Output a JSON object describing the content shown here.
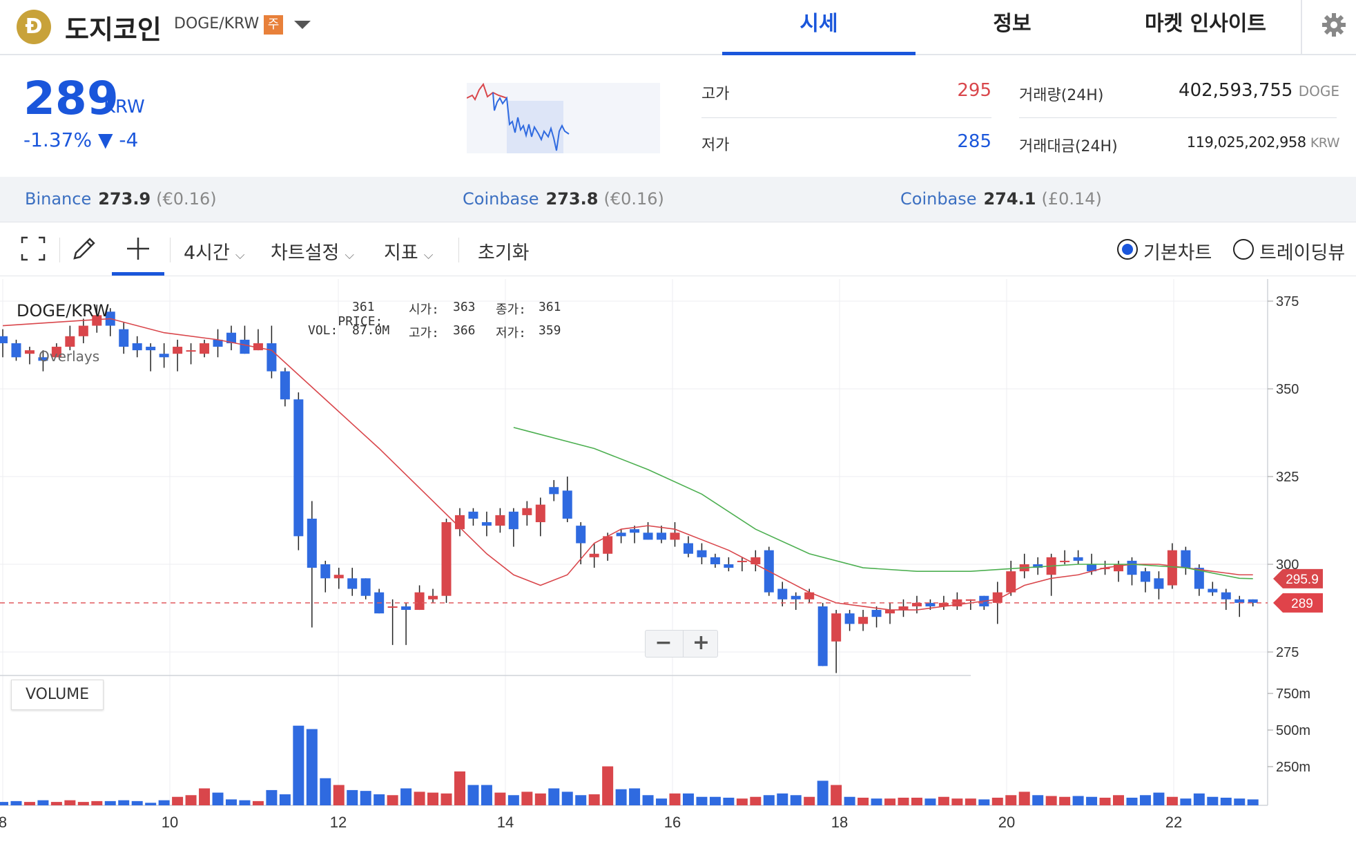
{
  "header": {
    "logo_letter": "Ð",
    "coin_name": "도지코인",
    "pair": "DOGE/KRW",
    "warning_badge": "주",
    "tabs": [
      {
        "label": "시세",
        "active": true
      },
      {
        "label": "정보",
        "active": false
      },
      {
        "label": "마켓 인사이트",
        "active": false
      }
    ]
  },
  "summary": {
    "price": "289",
    "unit": "KRW",
    "change": "-1.37% ▼ -4",
    "high_label": "고가",
    "high_value": "295",
    "low_label": "저가",
    "low_value": "285",
    "volume_label": "거래량(24H)",
    "volume_value": "402,593,755",
    "volume_unit": "DOGE",
    "amount_label": "거래대금(24H)",
    "amount_value": "119,025,202,958",
    "amount_unit": "KRW"
  },
  "exchanges": [
    {
      "name": "Binance",
      "price": "273.9",
      "converted": "(€0.16)"
    },
    {
      "name": "Coinbase",
      "price": "273.8",
      "converted": "(€0.16)"
    },
    {
      "name": "Coinbase",
      "price": "274.1",
      "converted": "(£0.14)"
    }
  ],
  "toolbar": {
    "interval": "4시간",
    "chart_settings": "차트설정",
    "indicators": "지표",
    "reset": "초기화",
    "basic_chart": "기본차트",
    "trading_view": "트레이딩뷰",
    "selected_view": "기본차트"
  },
  "chart_info": {
    "symbol": "DOGE/KRW",
    "overlays_label": "Overlays",
    "price_label": "PRICE:",
    "price_value": "361",
    "open_label": "시가:",
    "open_value": "363",
    "close_label": "종가:",
    "close_value": "361",
    "vol_label": "VOL:",
    "vol_value": "87.0M",
    "high_label": "고가:",
    "high_value": "366",
    "low_label": "저가:",
    "low_value": "359",
    "volume_panel_label": "VOLUME",
    "zoom_out": "−",
    "zoom_in": "+"
  },
  "colors": {
    "up": "#d9464b",
    "down": "#2f6ae0",
    "ma_short": "#d9464b",
    "ma_long": "#4caf50",
    "accent": "#1a56db"
  },
  "chart_data": {
    "type": "candlestick",
    "x_ticks": [
      "8",
      "10",
      "12",
      "14",
      "16",
      "18",
      "20",
      "22"
    ],
    "y_ticks": [
      375,
      350,
      325,
      300,
      275
    ],
    "volume_ticks": [
      "750m",
      "500m",
      "250m"
    ],
    "ylim": [
      271,
      375
    ],
    "current_price": 289,
    "ma_label_value": "295.9",
    "current_label_value": "289",
    "candles": [
      [
        365,
        363,
        367,
        359
      ],
      [
        363,
        359,
        364,
        358
      ],
      [
        360,
        361,
        362,
        357
      ],
      [
        359,
        358,
        361,
        355
      ],
      [
        359,
        362,
        363,
        359
      ],
      [
        362,
        365,
        368,
        361
      ],
      [
        365,
        368,
        370,
        363
      ],
      [
        368,
        371,
        374,
        366
      ],
      [
        372,
        368,
        373,
        365
      ],
      [
        367,
        362,
        369,
        360
      ],
      [
        363,
        361,
        365,
        359
      ],
      [
        362,
        361,
        363,
        355
      ],
      [
        360,
        359,
        363,
        356
      ],
      [
        360,
        362,
        364,
        355
      ],
      [
        361,
        361,
        363,
        357
      ],
      [
        360,
        363,
        364,
        359
      ],
      [
        364,
        362,
        367,
        359
      ],
      [
        366,
        363,
        368,
        361
      ],
      [
        364,
        360,
        368,
        360
      ],
      [
        361,
        363,
        367,
        361
      ],
      [
        363,
        355,
        368,
        353
      ],
      [
        355,
        347,
        356,
        345
      ],
      [
        347,
        308,
        349,
        304
      ],
      [
        313,
        299,
        318,
        282
      ],
      [
        300,
        296,
        301,
        292
      ],
      [
        296,
        297,
        299,
        293
      ],
      [
        296,
        293,
        299,
        291
      ],
      [
        296,
        291,
        296,
        290
      ],
      [
        292,
        286,
        293,
        286
      ],
      [
        288,
        288,
        290,
        277
      ],
      [
        288,
        287,
        289,
        277
      ],
      [
        287,
        292,
        294,
        287
      ],
      [
        290,
        291,
        293,
        289
      ],
      [
        291,
        312,
        313,
        289
      ],
      [
        310,
        314,
        316,
        308
      ],
      [
        315,
        313,
        316,
        311
      ],
      [
        312,
        311,
        315,
        308
      ],
      [
        311,
        314,
        316,
        309
      ],
      [
        315,
        310,
        316,
        305
      ],
      [
        314,
        316,
        318,
        311
      ],
      [
        312,
        317,
        319,
        308
      ],
      [
        322,
        320,
        324,
        318
      ],
      [
        321,
        313,
        325,
        312
      ],
      [
        311,
        306,
        312,
        300
      ],
      [
        302,
        303,
        306,
        299
      ],
      [
        303,
        308,
        309,
        301
      ],
      [
        309,
        308,
        310,
        306
      ],
      [
        310,
        309,
        311,
        306
      ],
      [
        309,
        307,
        312,
        307
      ],
      [
        309,
        307,
        311,
        306
      ],
      [
        307,
        309,
        312,
        305
      ],
      [
        306,
        303,
        308,
        302
      ],
      [
        304,
        302,
        306,
        300
      ],
      [
        302,
        300,
        303,
        299
      ],
      [
        300,
        299,
        302,
        298
      ],
      [
        301,
        301,
        302,
        298
      ],
      [
        300,
        302,
        304,
        298
      ],
      [
        304,
        292,
        305,
        291
      ],
      [
        293,
        290,
        295,
        288
      ],
      [
        291,
        290,
        292,
        287
      ],
      [
        290,
        292,
        293,
        289
      ],
      [
        288,
        271,
        289,
        271
      ],
      [
        278,
        286,
        287,
        269
      ],
      [
        286,
        283,
        287,
        281
      ],
      [
        283,
        285,
        287,
        281
      ],
      [
        287,
        285,
        288,
        282
      ],
      [
        286,
        287,
        289,
        283
      ],
      [
        287,
        288,
        290,
        285
      ],
      [
        288,
        289,
        291,
        286
      ],
      [
        289,
        288,
        290,
        287
      ],
      [
        288,
        289,
        291,
        287
      ],
      [
        288,
        290,
        292,
        287
      ],
      [
        290,
        290,
        290,
        287
      ],
      [
        291,
        288,
        291,
        287
      ],
      [
        289,
        292,
        295,
        283
      ],
      [
        292,
        298,
        301,
        291
      ],
      [
        298,
        300,
        303,
        296
      ],
      [
        300,
        299,
        302,
        297
      ],
      [
        297,
        302,
        303,
        291
      ],
      [
        301,
        301,
        304,
        300
      ],
      [
        302,
        301,
        304,
        300
      ],
      [
        300,
        298,
        303,
        297
      ],
      [
        299,
        299,
        301,
        297
      ],
      [
        298,
        300,
        301,
        295
      ],
      [
        301,
        297,
        302,
        294
      ],
      [
        298,
        295,
        299,
        292
      ],
      [
        296,
        293,
        298,
        290
      ],
      [
        294,
        304,
        306,
        293
      ],
      [
        304,
        299,
        305,
        297
      ],
      [
        299,
        293,
        300,
        291
      ],
      [
        293,
        292,
        295,
        291
      ],
      [
        292,
        290,
        293,
        287
      ],
      [
        290,
        289,
        291,
        285
      ],
      [
        290,
        289,
        290,
        288
      ]
    ],
    "volumes": [
      20,
      25,
      20,
      30,
      20,
      30,
      20,
      25,
      25,
      30,
      25,
      15,
      30,
      50,
      60,
      100,
      75,
      35,
      30,
      25,
      90,
      65,
      470,
      450,
      160,
      120,
      90,
      85,
      65,
      60,
      100,
      80,
      75,
      70,
      200,
      120,
      120,
      75,
      60,
      80,
      70,
      100,
      80,
      60,
      65,
      230,
      95,
      100,
      60,
      40,
      70,
      70,
      50,
      50,
      45,
      40,
      50,
      60,
      70,
      60,
      50,
      145,
      120,
      50,
      45,
      40,
      40,
      45,
      45,
      40,
      50,
      40,
      40,
      35,
      45,
      60,
      80,
      60,
      55,
      50,
      55,
      50,
      45,
      60,
      45,
      60,
      75,
      50,
      40,
      70,
      50,
      45,
      40,
      35
    ],
    "ma_short": [
      [
        0,
        368
      ],
      [
        4,
        369
      ],
      [
        8,
        370
      ],
      [
        12,
        366
      ],
      [
        16,
        364
      ],
      [
        20,
        361
      ],
      [
        24,
        347
      ],
      [
        28,
        333
      ],
      [
        32,
        318
      ],
      [
        36,
        303
      ],
      [
        38,
        297
      ],
      [
        40,
        294
      ],
      [
        42,
        297
      ],
      [
        44,
        306
      ],
      [
        46,
        310
      ],
      [
        48,
        311
      ],
      [
        50,
        310
      ],
      [
        52,
        307
      ],
      [
        54,
        304
      ],
      [
        56,
        300
      ],
      [
        58,
        296
      ],
      [
        60,
        292
      ],
      [
        62,
        289
      ],
      [
        64,
        288
      ],
      [
        66,
        287
      ],
      [
        68,
        287
      ],
      [
        70,
        288
      ],
      [
        72,
        289
      ],
      [
        74,
        290
      ],
      [
        76,
        294
      ],
      [
        78,
        296
      ],
      [
        80,
        297
      ],
      [
        82,
        299
      ],
      [
        84,
        300
      ],
      [
        86,
        300
      ],
      [
        88,
        299
      ],
      [
        90,
        298
      ],
      [
        92,
        297
      ],
      [
        93,
        297
      ]
    ],
    "ma_long": [
      [
        38,
        339
      ],
      [
        44,
        333
      ],
      [
        48,
        327
      ],
      [
        52,
        320
      ],
      [
        56,
        310
      ],
      [
        60,
        303
      ],
      [
        64,
        299
      ],
      [
        68,
        298
      ],
      [
        72,
        298
      ],
      [
        76,
        299
      ],
      [
        80,
        300
      ],
      [
        84,
        300
      ],
      [
        88,
        299
      ],
      [
        92,
        296
      ],
      [
        93,
        295.9
      ]
    ]
  }
}
